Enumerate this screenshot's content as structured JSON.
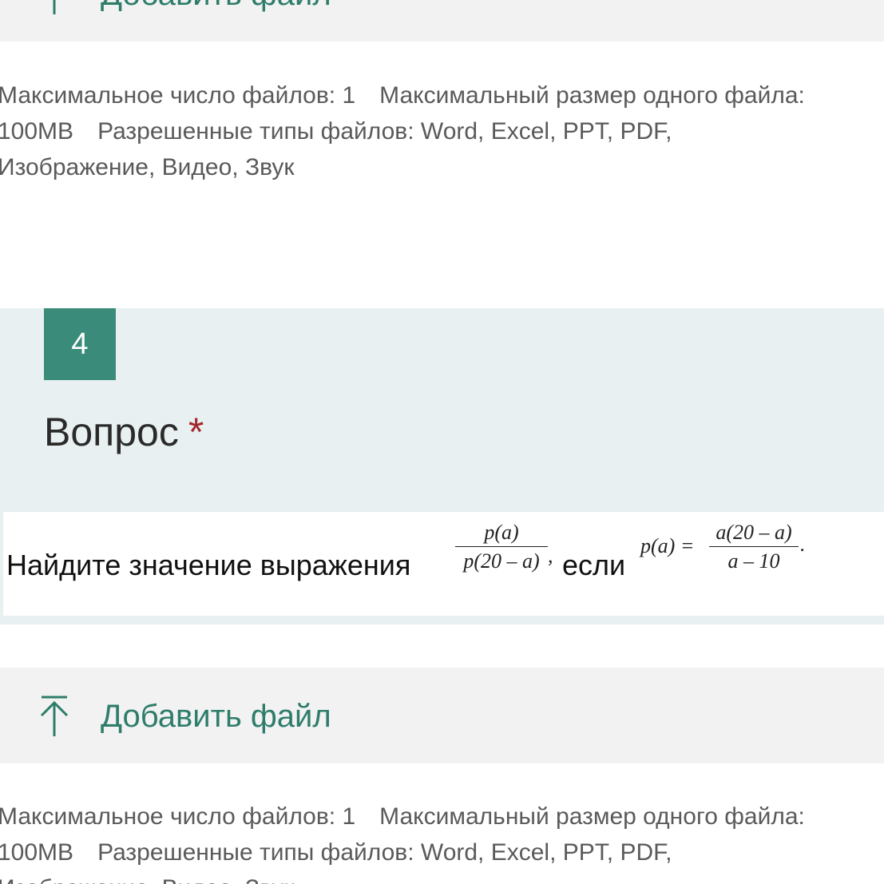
{
  "upload": {
    "add_file_label": "Добавить файл"
  },
  "limits": {
    "max_files": "Максимальное число файлов: 1",
    "max_size_label": "Максимальный размер одного файла:",
    "max_size_value": "100MB",
    "allowed_types": "Разрешенные типы файлов: Word, Excel, PPT, PDF,",
    "allowed_types_cont": "Изображение, Видео, Звук"
  },
  "question": {
    "number": "4",
    "title": "Вопрос",
    "required_mark": "*",
    "prompt_text": "Найдите значение выражения",
    "if_text": "если",
    "expr1_num": "p(a)",
    "expr1_den": "p(20 – a)",
    "expr1_punct": ",",
    "expr2_lhs": "p(a) =",
    "expr2_num": "a(20 – a)",
    "expr2_den": "a – 10",
    "expr2_punct": "."
  },
  "colors": {
    "accent": "#2e7d6b",
    "badge": "#3a8b79",
    "required": "#a4262c",
    "question_bg": "#e8f0f1",
    "upload_bg": "#f2f2f2"
  },
  "icons": {
    "upload": "upload-arrow-icon"
  }
}
